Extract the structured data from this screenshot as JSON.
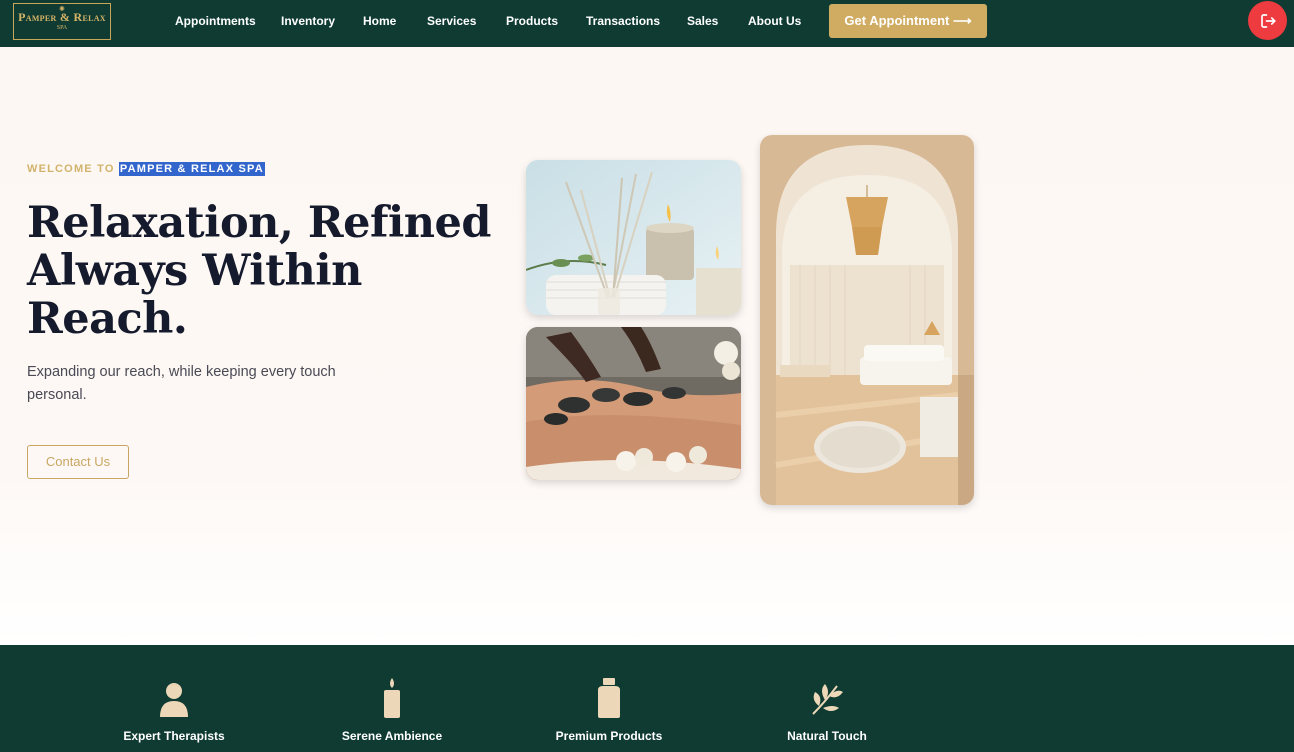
{
  "brand": {
    "name": "Pamper & Relax",
    "tagline": "SPA"
  },
  "nav": {
    "items": [
      {
        "label": "Appointments"
      },
      {
        "label": "Inventory"
      },
      {
        "label": "Home"
      },
      {
        "label": "Services"
      },
      {
        "label": "Products"
      },
      {
        "label": "Transactions"
      },
      {
        "label": "Sales"
      },
      {
        "label": "About Us"
      }
    ],
    "cta_label": "Get Appointment ⟶"
  },
  "hero": {
    "eyebrow_prefix": "WELCOME TO",
    "eyebrow_highlight": "PAMPER & RELAX SPA",
    "headline": [
      "Relaxation, Refined",
      "Always Within",
      "Reach."
    ],
    "subtitle": "Expanding our reach, while keeping every touch personal.",
    "contact_label": "Contact Us"
  },
  "features": [
    {
      "label": "Expert Therapists",
      "icon": "therapist-icon"
    },
    {
      "label": "Serene Ambience",
      "icon": "candle-icon"
    },
    {
      "label": "Premium Products",
      "icon": "bottle-icon"
    },
    {
      "label": "Natural Touch",
      "icon": "leaf-icon"
    }
  ],
  "colors": {
    "nav_bg": "#0f3b33",
    "accent_gold": "#cfac62",
    "logout_red": "#ee3b3f",
    "hero_bg": "#fdf8f5",
    "text_dark": "#151a2c",
    "selection": "#3366cc",
    "icon_cream": "#ecd8b8"
  }
}
